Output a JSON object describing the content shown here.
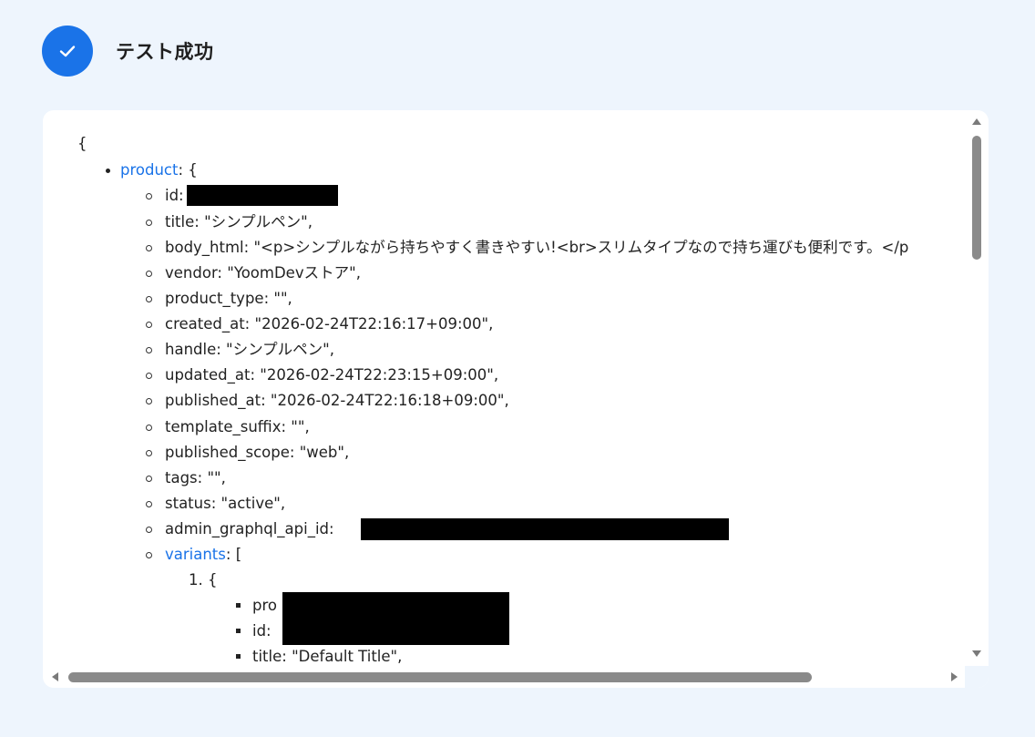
{
  "header": {
    "title": "テスト成功"
  },
  "json_view": {
    "open_brace": "{",
    "product_key": "product",
    "product_open": ": {",
    "fields": {
      "id": "id:",
      "title": "title: \"シンプルペン\",",
      "body_html": "body_html: \"<p>シンプルながら持ちやすく書きやすい!<br>スリムタイプなので持ち運びも便利です。</p",
      "vendor": "vendor: \"YoomDevストア\",",
      "product_type": "product_type: \"\",",
      "created_at": "created_at: \"2026-02-24T22:16:17+09:00\",",
      "handle": "handle: \"シンプルペン\",",
      "updated_at": "updated_at: \"2026-02-24T22:23:15+09:00\",",
      "published_at": "published_at: \"2026-02-24T22:16:18+09:00\",",
      "template_suffix": "template_suffix: \"\",",
      "published_scope": "published_scope: \"web\",",
      "tags": "tags: \"\",",
      "status": "status: \"active\",",
      "admin_graphql_api_id": "admin_graphql_api_id:"
    },
    "variants_key": "variants",
    "variants_open": ": [",
    "variant_index": "1. {",
    "variant_fields": {
      "product_id": "pro",
      "id": "id:",
      "title": "title: \"Default Title\","
    }
  },
  "colors": {
    "accent": "#1a73e8",
    "background": "#eef5fd",
    "panel": "#ffffff",
    "link": "#1a73e8"
  },
  "icons": {
    "success": "check-icon"
  }
}
